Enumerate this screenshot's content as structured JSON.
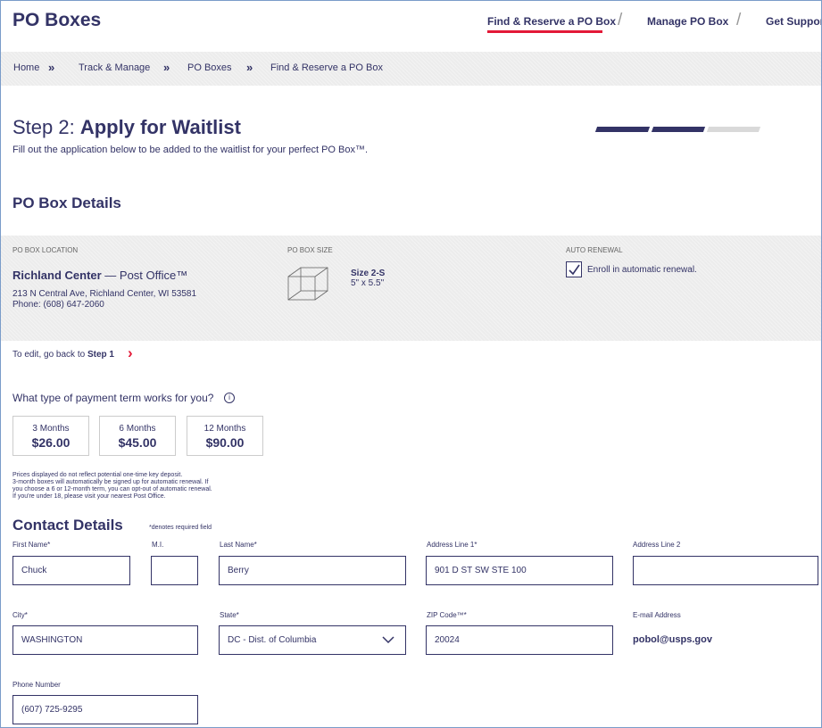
{
  "header": {
    "brand": "PO Boxes",
    "nav": [
      "Find & Reserve a PO Box",
      "Manage PO Box",
      "Get Support"
    ],
    "nav_sep": "/"
  },
  "breadcrumb": {
    "items": [
      "Home",
      "Track & Manage",
      "PO Boxes",
      "Find & Reserve a PO Box"
    ],
    "sep": "»"
  },
  "step": {
    "prefix": "Step 2: ",
    "title": "Apply for Waitlist",
    "subtitle": "Fill out the application below to be added to the waitlist for your perfect PO Box™.",
    "progress_completed": 2,
    "progress_total": 3
  },
  "details": {
    "section_title": "PO Box Details",
    "location_label": "PO BOX LOCATION",
    "location_name": "Richland Center",
    "location_suffix": " — Post Office™",
    "address": "213 N Central Ave, Richland Center, WI 53581",
    "phone": "Phone: (608) 647-2060",
    "size_label": "PO BOX SIZE",
    "size_name": "Size 2-S",
    "size_dim": "5\" x 5.5\"",
    "renewal_label": "AUTO RENEWAL",
    "renewal_text": "Enroll in automatic renewal.",
    "renewal_checked": true
  },
  "edit": {
    "prefix": "To edit, go back to ",
    "link": "Step 1",
    "chevron": "›"
  },
  "payment": {
    "question": "What type of payment term works for you?",
    "info_icon": "i",
    "terms": [
      {
        "label": "3 Months",
        "price": "$26.00"
      },
      {
        "label": "6 Months",
        "price": "$45.00"
      },
      {
        "label": "12 Months",
        "price": "$90.00"
      }
    ],
    "disclaimer": [
      "Prices displayed do not reflect potential one-time key deposit.",
      "3-month boxes will automatically be signed up for automatic renewal. If",
      "you choose a 6 or 12-month term, you can opt-out of automatic renewal.",
      "If you're under 18, please visit your nearest Post Office."
    ]
  },
  "contact": {
    "title": "Contact Details",
    "required_note": "*denotes required field",
    "first_name_label": "First Name*",
    "first_name": "Chuck",
    "mi_label": "M.I.",
    "mi": "",
    "last_name_label": "Last Name*",
    "last_name": "Berry",
    "addr1_label": "Address Line 1*",
    "addr1": "901 D ST SW STE 100",
    "addr2_label": "Address Line 2",
    "addr2": "",
    "city_label": "City*",
    "city": "WASHINGTON",
    "state_label": "State*",
    "state": "DC - Dist. of Columbia",
    "zip_label": "ZIP Code™*",
    "zip": "20024",
    "email_label": "E-mail Address",
    "email": "pobol@usps.gov",
    "phone_label": "Phone Number",
    "phone": "(607) 725-9295"
  }
}
